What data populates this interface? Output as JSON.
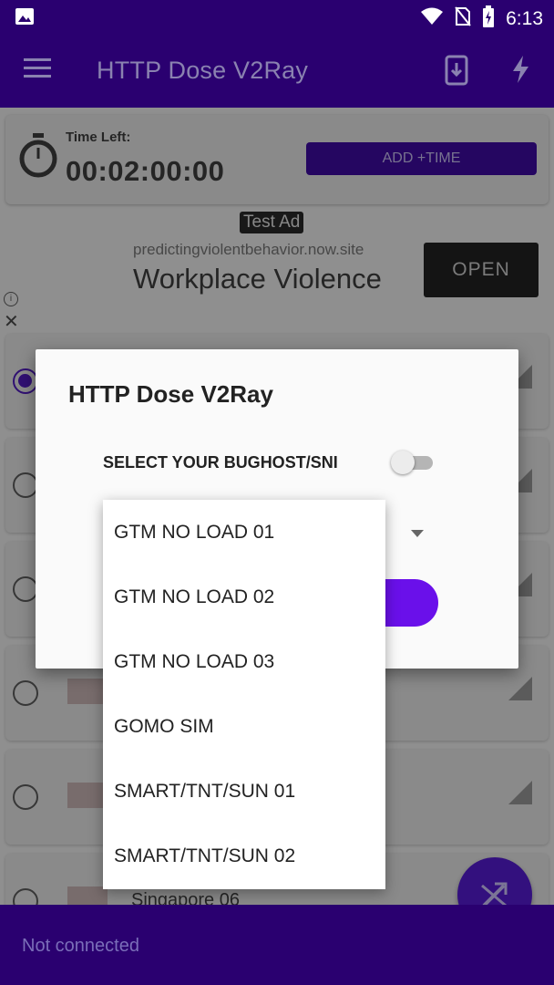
{
  "status_bar": {
    "time": "6:13"
  },
  "app_bar": {
    "title": "HTTP Dose V2Ray"
  },
  "timer": {
    "label": "Time Left:",
    "value": "00:02:00:00",
    "add_button": "ADD +TIME"
  },
  "ad": {
    "badge": "Test Ad",
    "domain": "predictingviolentbehavior.now.site",
    "headline": "Workplace Violence",
    "cta": "OPEN"
  },
  "server_list": {
    "partial_visible_name": "Singapore 06"
  },
  "dialog": {
    "title": "HTTP Dose V2Ray",
    "sni_label": "SELECT YOUR BUGHOST/SNI",
    "sni_toggle_on": false
  },
  "dropdown": {
    "options": [
      "GTM NO LOAD 01",
      "GTM NO LOAD 02",
      "GTM NO LOAD 03",
      "GOMO SIM",
      "SMART/TNT/SUN 01",
      "SMART/TNT/SUN 02"
    ]
  },
  "bottom_bar": {
    "status": "Not connected"
  },
  "colors": {
    "primary": "#2a0070",
    "accent": "#6a10ea"
  }
}
